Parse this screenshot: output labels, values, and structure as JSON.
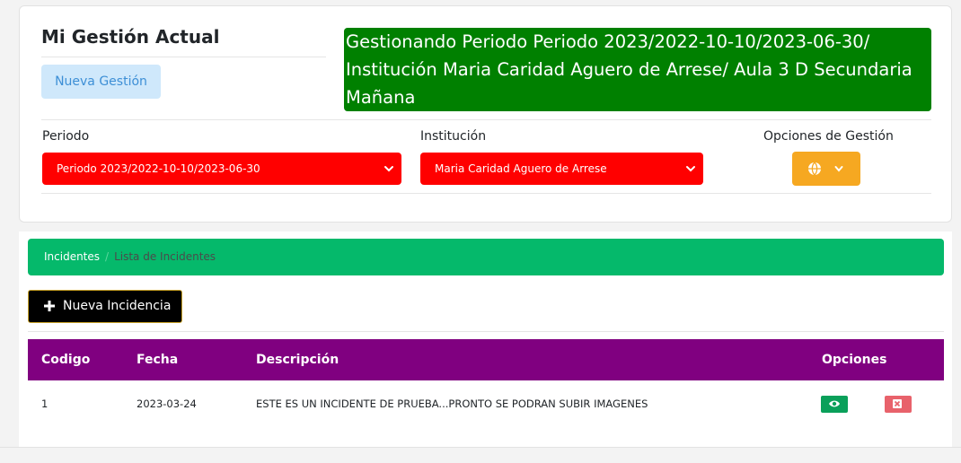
{
  "header": {
    "title": "Mi Gestión Actual",
    "new_button": "Nueva Gestión",
    "banner": "Gestionando Periodo Periodo 2023/2022-10-10/2023-06-30/ Institución Maria Caridad Aguero de Arrese/ Aula 3 D Secundaria Mañana"
  },
  "filters": {
    "periodo_label": "Periodo",
    "periodo_value": "Periodo 2023/2022-10-10/2023-06-30",
    "institucion_label": "Institución",
    "institucion_value": "Maria Caridad Aguero de Arrese",
    "opciones_label": "Opciones de Gestión"
  },
  "breadcrumb": {
    "items": [
      "Incidentes",
      "Lista de Incidentes"
    ],
    "separator": "/"
  },
  "actions": {
    "new_incident": "Nueva Incidencia"
  },
  "table": {
    "columns": [
      "Codigo",
      "Fecha",
      "Descripción",
      "Opciones"
    ],
    "rows": [
      {
        "codigo": "1",
        "fecha": "2023-03-24",
        "descripcion": "ESTE ES UN INCIDENTE DE PRUEBA...PRONTO SE PODRAN SUBIR IMAGENES"
      }
    ]
  },
  "colors": {
    "banner": "#008000",
    "select": "#ff0000",
    "options_button": "#f6a821",
    "breadcrumb": "#05b96b",
    "table_header": "#800080",
    "view_button": "#0aa05a",
    "delete_button": "#e8626b"
  },
  "icons": {
    "options": [
      "globe-icon",
      "chevron-down-icon"
    ],
    "new_incident": "plus-icon",
    "row_actions": [
      "eye-icon",
      "close-icon"
    ]
  }
}
